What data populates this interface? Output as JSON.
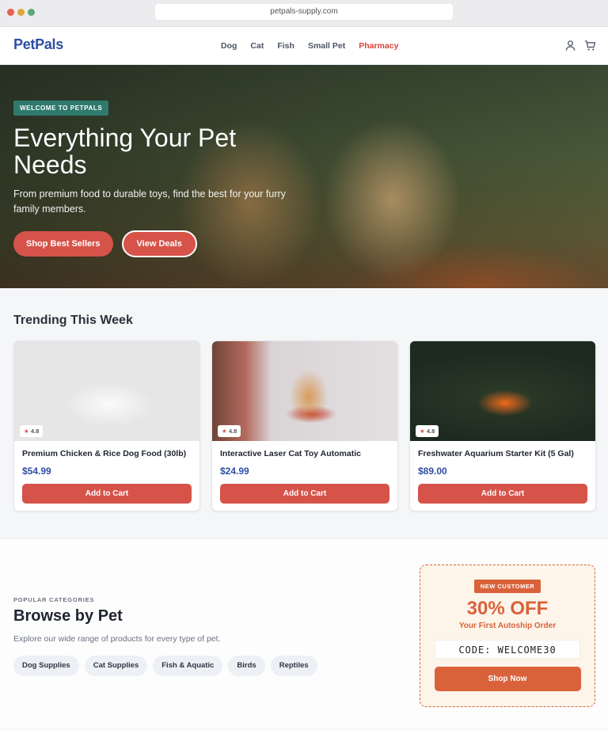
{
  "browser": {
    "url": "petpals-supply.com"
  },
  "header": {
    "logo": "PetPals",
    "nav": [
      "Dog",
      "Cat",
      "Fish",
      "Small Pet",
      "Pharmacy"
    ],
    "icons": [
      "user-icon",
      "cart-icon"
    ]
  },
  "hero": {
    "badge": "WELCOME TO PETPALS",
    "title": "Everything Your Pet Needs",
    "subtitle": "From premium food to durable toys, find the best for your furry family members.",
    "primary_button": "Shop Best Sellers",
    "secondary_button": "View Deals"
  },
  "trending": {
    "title": "Trending This Week",
    "products": [
      {
        "name": "Premium Chicken & Rice Dog Food (30lb)",
        "price": "$54.99",
        "rating": "4.8",
        "button": "Add to Cart"
      },
      {
        "name": "Interactive Laser Cat Toy Automatic",
        "price": "$24.99",
        "rating": "4.8",
        "button": "Add to Cart"
      },
      {
        "name": "Freshwater Aquarium Starter Kit (5 Gal)",
        "price": "$89.00",
        "rating": "4.8",
        "button": "Add to Cart"
      }
    ]
  },
  "categories": {
    "eyebrow": "POPULAR CATEGORIES",
    "title": "Browse by Pet",
    "subtitle": "Explore our wide range of products for every type of pet.",
    "chips": [
      "Dog Supplies",
      "Cat Supplies",
      "Fish & Aquatic",
      "Birds",
      "Reptiles"
    ]
  },
  "promo": {
    "badge": "NEW CUSTOMER",
    "headline": "30% OFF",
    "subline": "Your First Autoship Order",
    "code": "CODE: WELCOME30",
    "button": "Shop Now"
  },
  "colors": {
    "brand": "#2e4ea3",
    "accent": "#d6534a",
    "promo": "#d9623a",
    "badge": "#2f7a6d"
  }
}
